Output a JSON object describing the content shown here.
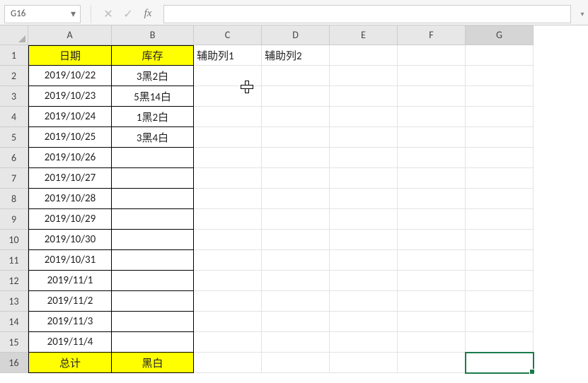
{
  "name_box": "G16",
  "formula_value": "",
  "fx_label": "fx",
  "cancel_glyph": "✕",
  "enter_glyph": "✓",
  "columns": [
    "A",
    "B",
    "C",
    "D",
    "E",
    "F",
    "G"
  ],
  "row_numbers": [
    "1",
    "2",
    "3",
    "4",
    "5",
    "6",
    "7",
    "8",
    "9",
    "10",
    "11",
    "12",
    "13",
    "14",
    "15",
    "16"
  ],
  "headers": {
    "A1": "日期",
    "B1": "库存",
    "C1": "辅助列1",
    "D1": "辅助列2"
  },
  "rows": [
    {
      "date": "2019/10/22",
      "stock": "3黑2白"
    },
    {
      "date": "2019/10/23",
      "stock": "5黑14白"
    },
    {
      "date": "2019/10/24",
      "stock": "1黑2白"
    },
    {
      "date": "2019/10/25",
      "stock": "3黑4白"
    },
    {
      "date": "2019/10/26",
      "stock": ""
    },
    {
      "date": "2019/10/27",
      "stock": ""
    },
    {
      "date": "2019/10/28",
      "stock": ""
    },
    {
      "date": "2019/10/29",
      "stock": ""
    },
    {
      "date": "2019/10/30",
      "stock": ""
    },
    {
      "date": "2019/10/31",
      "stock": ""
    },
    {
      "date": "2019/11/1",
      "stock": ""
    },
    {
      "date": "2019/11/2",
      "stock": ""
    },
    {
      "date": "2019/11/3",
      "stock": ""
    },
    {
      "date": "2019/11/4",
      "stock": ""
    }
  ],
  "totals": {
    "A16": "总计",
    "B16": "黑白"
  },
  "selected_cell": "G16"
}
